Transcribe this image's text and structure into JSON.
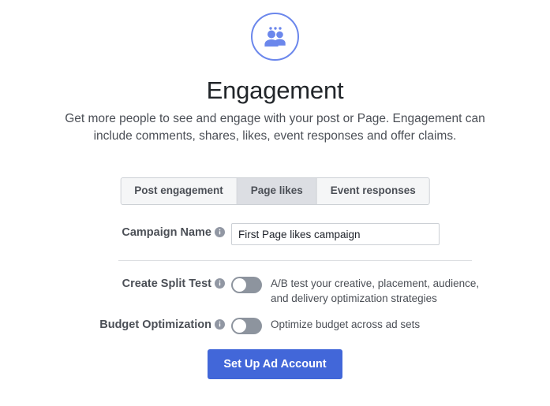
{
  "header": {
    "icon_name": "engagement-people-icon",
    "icon_color": "#6b87ec",
    "title": "Engagement",
    "description": "Get more people to see and engage with your post or Page. Engagement can include comments, shares, likes, event responses and offer claims."
  },
  "tabs": [
    {
      "label": "Post engagement",
      "selected": false
    },
    {
      "label": "Page likes",
      "selected": true
    },
    {
      "label": "Event responses",
      "selected": false
    }
  ],
  "form": {
    "campaign_name": {
      "label": "Campaign Name",
      "value": "First Page likes campaign",
      "placeholder": "Campaign Name"
    }
  },
  "toggles": [
    {
      "label": "Create Split Test",
      "state": "off",
      "description": "A/B test your creative, placement, audience, and delivery optimization strategies"
    },
    {
      "label": "Budget Optimization",
      "state": "off",
      "description": "Optimize budget across ad sets"
    }
  ],
  "cta": {
    "label": "Set Up Ad Account",
    "color": "#4267d9"
  },
  "colors": {
    "accent_blue": "#4267d9",
    "icon_blue": "#6b87ec",
    "tab_selected_bg": "#dcdee3",
    "tab_bg": "#f5f6f7",
    "border": "#ccd0d5",
    "text_dark": "#1d2129",
    "text_muted": "#4b4f56",
    "switch_track": "#8d949e"
  }
}
